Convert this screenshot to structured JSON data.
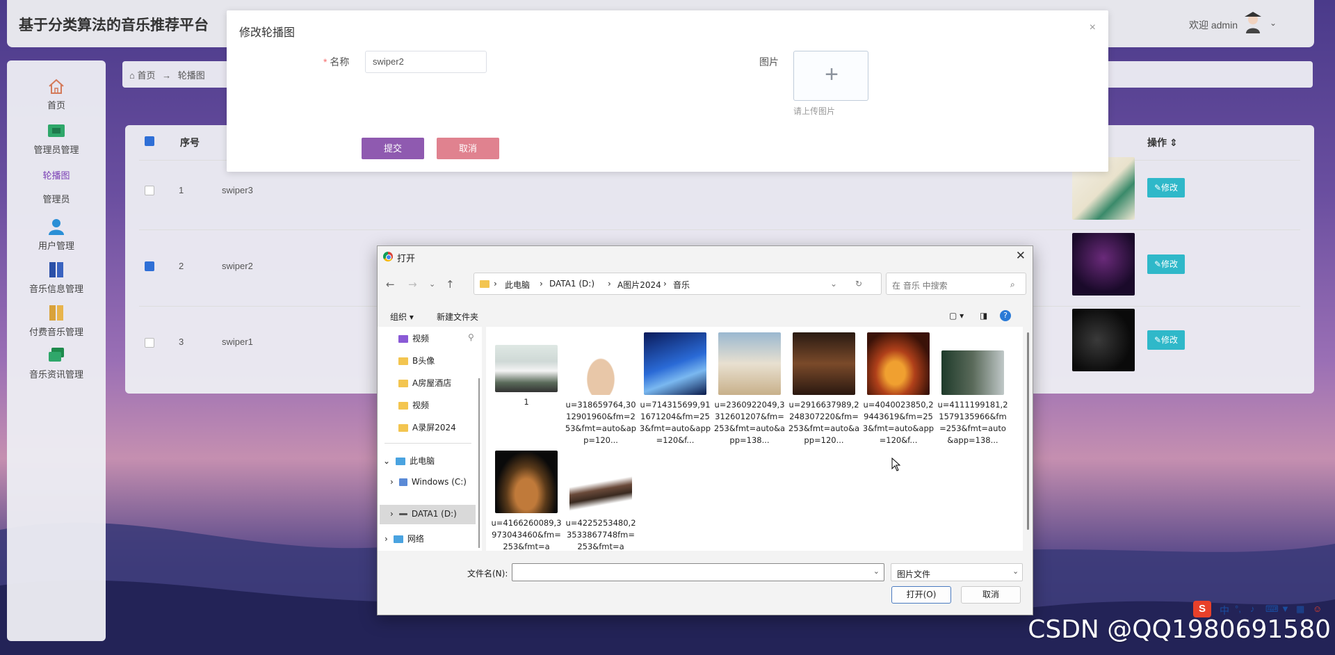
{
  "app": {
    "title": "基于分类算法的音乐推荐平台",
    "welcome": "欢迎 admin"
  },
  "sidebar": {
    "items": [
      {
        "label": "首页",
        "icon": "home-icon"
      },
      {
        "label": "管理员管理",
        "icon": "ticket-icon"
      },
      {
        "label": "轮播图",
        "icon": ""
      },
      {
        "label": "管理员",
        "icon": ""
      },
      {
        "label": "用户管理",
        "icon": "user-icon"
      },
      {
        "label": "音乐信息管理",
        "icon": "book-icon"
      },
      {
        "label": "付费音乐管理",
        "icon": "book-icon"
      },
      {
        "label": "音乐资讯管理",
        "icon": "chat-icon"
      }
    ]
  },
  "breadcrumb": {
    "home": "首页",
    "arrow": "→",
    "current": "轮播图"
  },
  "table": {
    "headers": {
      "index": "序号",
      "action": "操作 ⇕"
    },
    "rows": [
      {
        "index": "1",
        "name": "swiper3",
        "checked": false,
        "edit": "修改"
      },
      {
        "index": "2",
        "name": "swiper2",
        "checked": true,
        "edit": "修改"
      },
      {
        "index": "3",
        "name": "swiper1",
        "checked": false,
        "edit": "修改"
      }
    ]
  },
  "edit_dialog": {
    "title": "修改轮播图",
    "close": "×",
    "name_label": "名称",
    "name_required": "*",
    "name_value": "swiper2",
    "image_label": "图片",
    "upload_plus": "+",
    "upload_hint": "请上传图片",
    "submit": "提交",
    "cancel": "取消",
    "colors": {
      "submit": "#8f5ab0",
      "cancel": "#e0828f"
    }
  },
  "file_dialog": {
    "title": "打开",
    "close": "✕",
    "address": [
      "此电脑",
      "DATA1 (D:)",
      "A图片2024",
      "音乐"
    ],
    "search_placeholder": "在 音乐 中搜索",
    "toolbar": {
      "organize": "组织 ▾",
      "new_folder": "新建文件夹"
    },
    "tree": [
      "视频",
      "B头像",
      "A房屋酒店",
      "视频",
      "A录屏2024",
      "此电脑",
      "Windows (C:)",
      "DATA1 (D:)",
      "网络"
    ],
    "files": [
      {
        "name": "1"
      },
      {
        "name": "u=318659764,3012901960&fm=253&fmt=auto&app=120..."
      },
      {
        "name": "u=714315699,911671204&fm=253&fmt=auto&app=120&f..."
      },
      {
        "name": "u=2360922049,3312601207&fm=253&fmt=auto&app=138..."
      },
      {
        "name": "u=2916637989,2248307220&fm=253&fmt=auto&app=120..."
      },
      {
        "name": "u=4040023850,29443619&fm=253&fmt=auto&app=120&f..."
      },
      {
        "name": "u=4111199181,21579135966&fm=253&fmt=auto&app=138..."
      },
      {
        "name": "u=4166260089,3973043460&fm=253&fmt=a"
      },
      {
        "name": "u=4225253480,23533867748fm=253&fmt=a"
      }
    ],
    "filename_label": "文件名(N):",
    "filetype": "图片文件",
    "open": "打开(O)",
    "cancel": "取消"
  },
  "watermark": "CSDN @QQ1980691580",
  "ime": {
    "lang": "中"
  }
}
